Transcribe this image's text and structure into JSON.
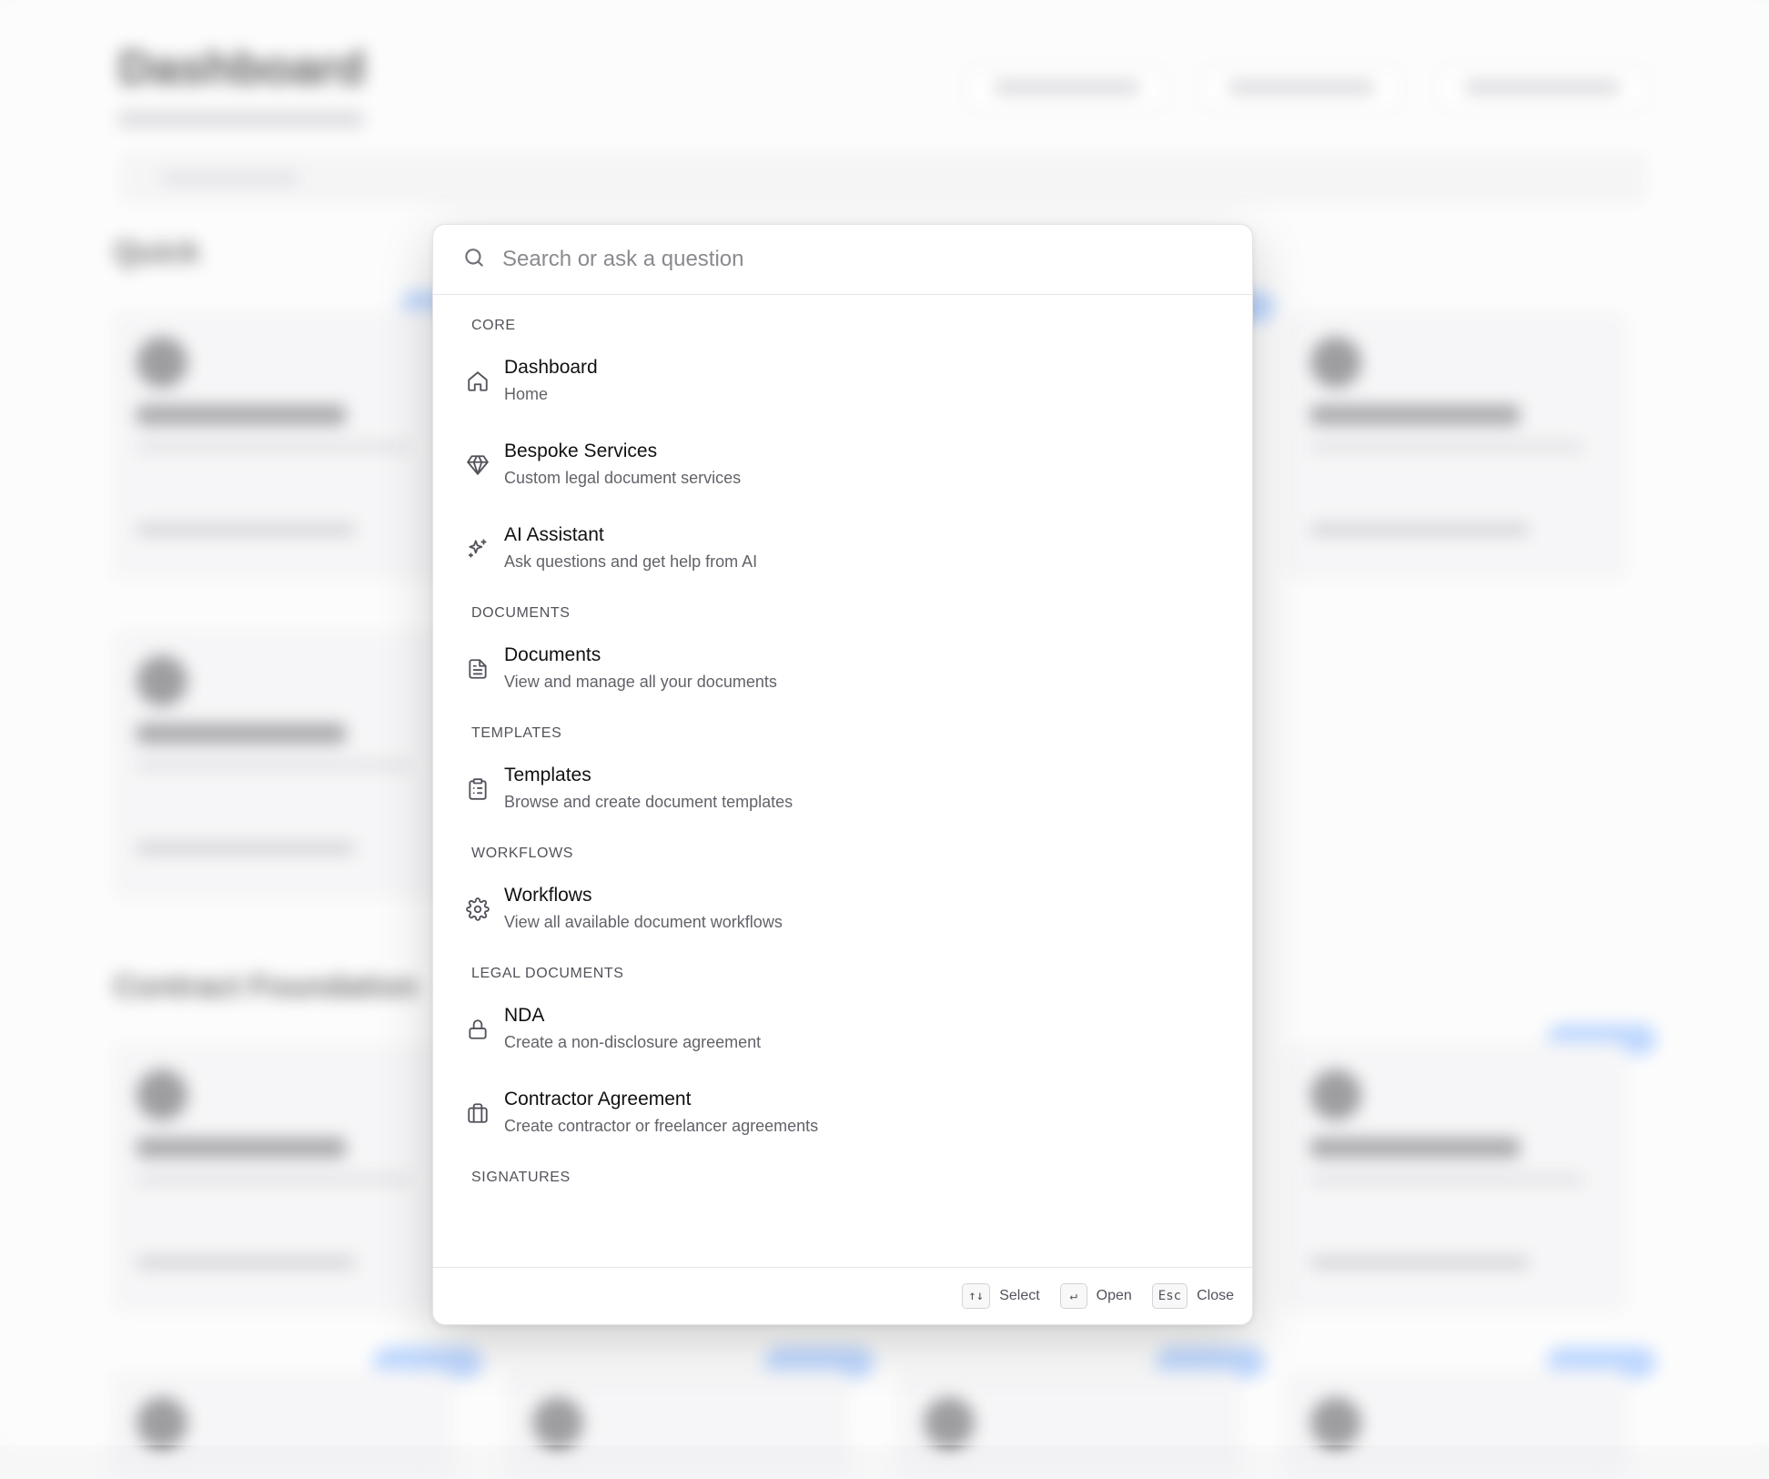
{
  "search": {
    "placeholder": "Search or ask a question"
  },
  "groups": [
    {
      "label": "CORE",
      "items": [
        {
          "title": "Dashboard",
          "desc": "Home",
          "icon": "home-icon"
        },
        {
          "title": "Bespoke Services",
          "desc": "Custom legal document services",
          "icon": "gem-icon"
        },
        {
          "title": "AI Assistant",
          "desc": "Ask questions and get help from AI",
          "icon": "sparkles-icon"
        }
      ]
    },
    {
      "label": "DOCUMENTS",
      "items": [
        {
          "title": "Documents",
          "desc": "View and manage all your documents",
          "icon": "file-text-icon"
        }
      ]
    },
    {
      "label": "TEMPLATES",
      "items": [
        {
          "title": "Templates",
          "desc": "Browse and create document templates",
          "icon": "clipboard-list-icon"
        }
      ]
    },
    {
      "label": "WORKFLOWS",
      "items": [
        {
          "title": "Workflows",
          "desc": "View all available document workflows",
          "icon": "gear-icon"
        }
      ]
    },
    {
      "label": "LEGAL DOCUMENTS",
      "items": [
        {
          "title": "NDA",
          "desc": "Create a non-disclosure agreement",
          "icon": "lock-icon"
        },
        {
          "title": "Contractor Agreement",
          "desc": "Create contractor or freelancer agreements",
          "icon": "briefcase-icon"
        }
      ]
    },
    {
      "label": "SIGNATURES",
      "items": []
    }
  ],
  "footer": {
    "select_key": "↑↓",
    "select_label": "Select",
    "open_key": "↵",
    "open_label": "Open",
    "close_key": "Esc",
    "close_label": "Close"
  },
  "background": {
    "title": "Dashboard",
    "section_1": "Quick",
    "section_2": "Contract Foundation"
  }
}
